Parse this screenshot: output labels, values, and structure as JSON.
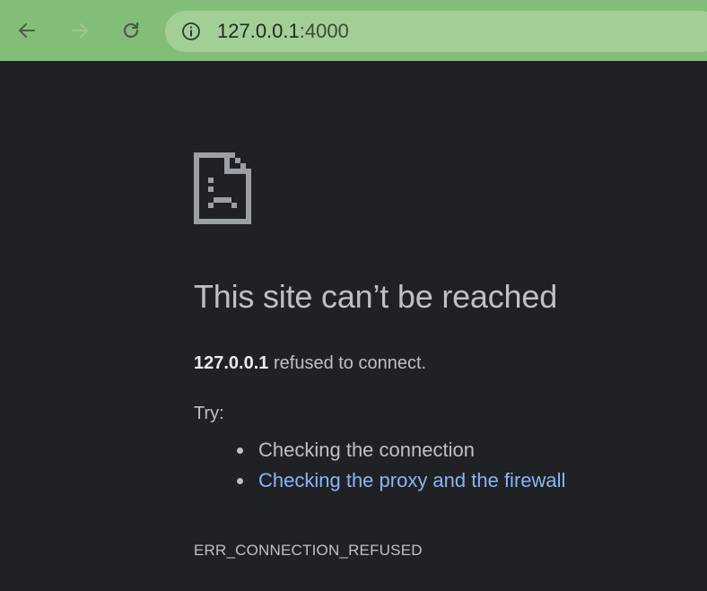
{
  "browser": {
    "url_host": "127.0.0.1",
    "url_port": ":4000",
    "colors": {
      "toolbar": "#82be77",
      "omnibox": "#a3cf96",
      "page_background": "#202124",
      "text": "#bdc1c6",
      "link": "#8ab4f8"
    },
    "icons": {
      "back": "arrow-left-icon",
      "forward": "arrow-right-icon",
      "reload": "reload-icon",
      "site_info": "info-icon"
    }
  },
  "error_page": {
    "icon": "sad-page-icon",
    "title": "This site can’t be reached",
    "host": "127.0.0.1",
    "message_suffix": " refused to connect.",
    "try_label": "Try:",
    "suggestions": [
      "Checking the connection",
      "Checking the proxy and the firewall"
    ],
    "error_code": "ERR_CONNECTION_REFUSED"
  }
}
